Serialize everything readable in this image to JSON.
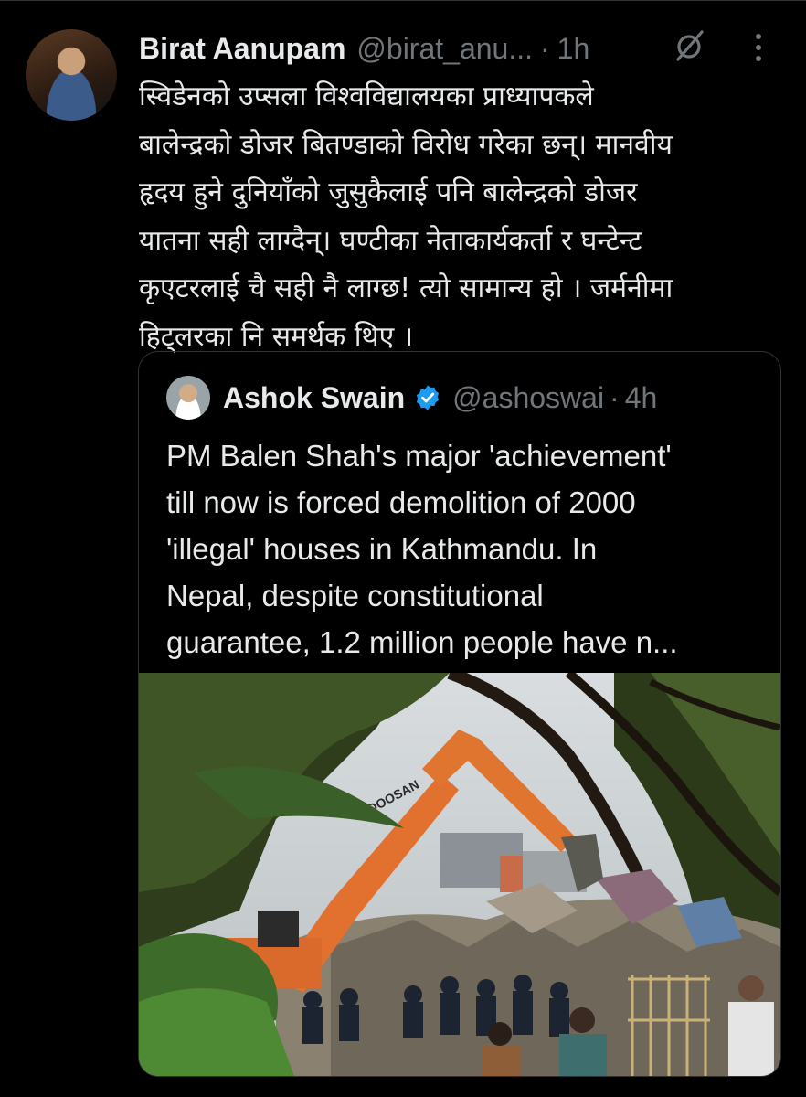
{
  "author": {
    "name": "Birat Aanupam",
    "handle": "@birat_anu...",
    "separator": "·",
    "time": "1h"
  },
  "tweet": {
    "text": "स्विडेनको उप्सला विश्वविद्यालयका प्राध्यापकले\nबालेन्द्रको डोजर बितण्डाको विरोध गरेका छन्। मानवीय\nहृदय हुने दुनियाँको जुसुकैलाई पनि बालेन्द्रको डोजर\nयातना सही लाग्दैन्। घण्टीका नेताकार्यकर्ता र घन्टेन्ट\nकृएटरलाई चै सही नै लाग्छ!  त्यो सामान्य हो । जर्मनीमा\nहिट्लरका नि समर्थक थिए ।"
  },
  "quoted": {
    "name": "Ashok Swain",
    "handle": "@ashoswai",
    "separator": "·",
    "time": "4h",
    "text": "PM Balen Shah's major 'achievement'\ntill now is  forced demolition of 2000\n'illegal' houses in Kathmandu. In\nNepal, despite constitutional\nguarantee, 1.2 million people have n...",
    "image_text": "DOOSAN"
  },
  "icons": {
    "grok": "grok-icon",
    "more": "more-options-icon",
    "verified": "verified-badge-icon"
  },
  "colors": {
    "background": "#000000",
    "text": "#e7e9ea",
    "secondary": "#71767b",
    "verified": "#1d9bf0",
    "border": "#2f3336"
  }
}
